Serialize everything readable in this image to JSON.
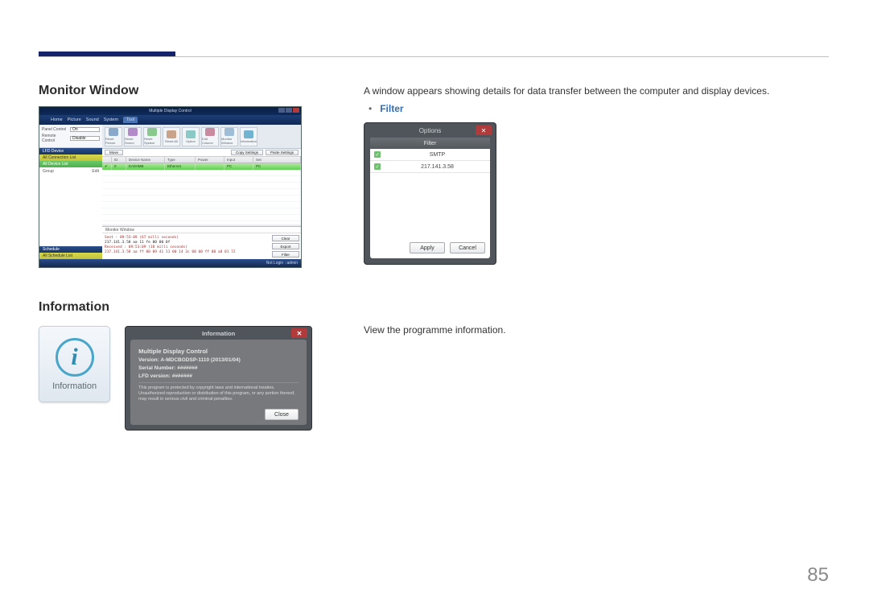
{
  "page_number": "85",
  "sections": {
    "monitor_window_heading": "Monitor Window",
    "information_heading": "Information"
  },
  "descriptions": {
    "monitor_window": "A window appears showing details for data transfer between the computer and display devices.",
    "filter_label": "Filter",
    "information": "View the programme information."
  },
  "mdc": {
    "title": "Multiple Display Control",
    "tabs": [
      "Home",
      "Picture",
      "Sound",
      "System",
      "Tool"
    ],
    "active_tab": "Tool",
    "panel_control": {
      "label": "Panel Control",
      "value": "On"
    },
    "remote_control": {
      "label": "Remote Control",
      "value": "Disable"
    },
    "toolbar": [
      "Reset Picture",
      "Reset Sound",
      "Reset System",
      "Reset All",
      "Option",
      "Edit Column",
      "Monitor Window",
      "Information"
    ],
    "actionbar": {
      "move": "Move",
      "copy": "Copy Settings",
      "paste": "Paste Settings"
    },
    "tree": {
      "lfd_device": "LFD Device",
      "all_connection_list": "All Connection List",
      "all_device_list": "All Device List",
      "group": "Group",
      "edit": "Edit",
      "schedule": "Schedule",
      "all_schedule_list": "All Schedule List"
    },
    "grid": {
      "headers": [
        "",
        "ID",
        "Device Name",
        "Type",
        "Power",
        "Input",
        "Set"
      ],
      "row": {
        "id": "0",
        "name": "EA0HMB",
        "type": "Ethernet",
        "power": "",
        "input": "PC",
        "setting": "PC"
      }
    },
    "monitor": {
      "header": "Monitor Window",
      "lines": [
        "Sent : 09:53:09 (67 milli seconds)",
        "217.141.3.58  aa 11 fe 00 00 0f",
        "Received : 09:53:09 (18 milli seconds)",
        "217.141.3.58  aa ff 00 09 41 11 00 14 3c 00 00 ff 00 a8 01 72"
      ],
      "buttons": {
        "clear": "Clear",
        "export": "Export",
        "filter": "Filter"
      }
    },
    "status": "Not Login : admin"
  },
  "options_dialog": {
    "title": "Options",
    "filter": "Filter",
    "rows": [
      {
        "checked": true,
        "value": "SMTP"
      },
      {
        "checked": true,
        "value": "217.141.3.58"
      }
    ],
    "apply": "Apply",
    "cancel": "Cancel"
  },
  "info_icon": {
    "glyph": "i",
    "label": "Information"
  },
  "info_dialog": {
    "title": "Information",
    "product": "Multiple Display Control",
    "version": "Version: A-MDCBGDSP-1110 (2013/01/04)",
    "serial": "Serial Number: #######",
    "lfd": "LFD version: #######",
    "copyright": "This program is protected by copyright laws and international treaties. Unauthorized reproduction or distribution of this program, or any portion thereof, may result in serious civil and criminal penalties.",
    "close": "Close"
  }
}
